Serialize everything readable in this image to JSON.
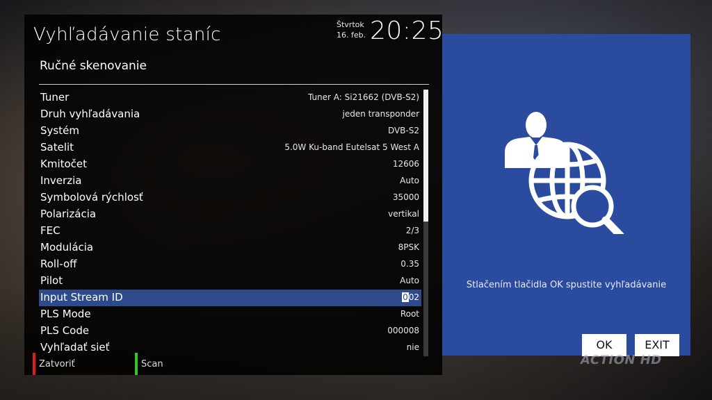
{
  "header": {
    "title": "Vyhľadávanie staníc",
    "day": "Štvrtok",
    "date": "16. feb.",
    "time": "20:25",
    "subtitle": "Ručné skenovanie"
  },
  "settings": [
    {
      "label": "Tuner",
      "value": "Tuner A: Si21662 (DVB-S2)"
    },
    {
      "label": "Druh vyhľadávania",
      "value": "jeden transponder"
    },
    {
      "label": "Systém",
      "value": "DVB-S2"
    },
    {
      "label": "Satelit",
      "value": "5.0W Ku-band Eutelsat 5 West A"
    },
    {
      "label": "Kmitočet",
      "value": "12606"
    },
    {
      "label": "Inverzia",
      "value": "Auto"
    },
    {
      "label": "Symbolová rýchlosť",
      "value": "35000"
    },
    {
      "label": "Polarizácia",
      "value": "vertikal"
    },
    {
      "label": "FEC",
      "value": "2/3"
    },
    {
      "label": "Modulácia",
      "value": "8PSK"
    },
    {
      "label": "Roll-off",
      "value": "0.35"
    },
    {
      "label": "Pilot",
      "value": "Auto"
    },
    {
      "label": "Input Stream ID",
      "value": "002",
      "value_prefix": "",
      "value_cursor": "0",
      "value_rest": "02"
    },
    {
      "label": "PLS Mode",
      "value": "Root"
    },
    {
      "label": "PLS Code",
      "value": "000008"
    },
    {
      "label": "Vyhľadať sieť",
      "value": "nie"
    }
  ],
  "selected_index": 12,
  "footer": {
    "red_label": "Zatvoriť",
    "green_label": "Scan"
  },
  "info": {
    "text": "Stlačením tlačidla OK spustite vyhľadávanie",
    "icon": "person-globe-search-icon"
  },
  "buttons": {
    "ok_label": "OK",
    "exit_label": "EXIT"
  },
  "channel_logo": "ACTION HD",
  "colors": {
    "selection": "#2d4a8c",
    "info_panel": "#2a4b9e",
    "red_key": "#e21b1b",
    "green_key": "#39c12e"
  }
}
